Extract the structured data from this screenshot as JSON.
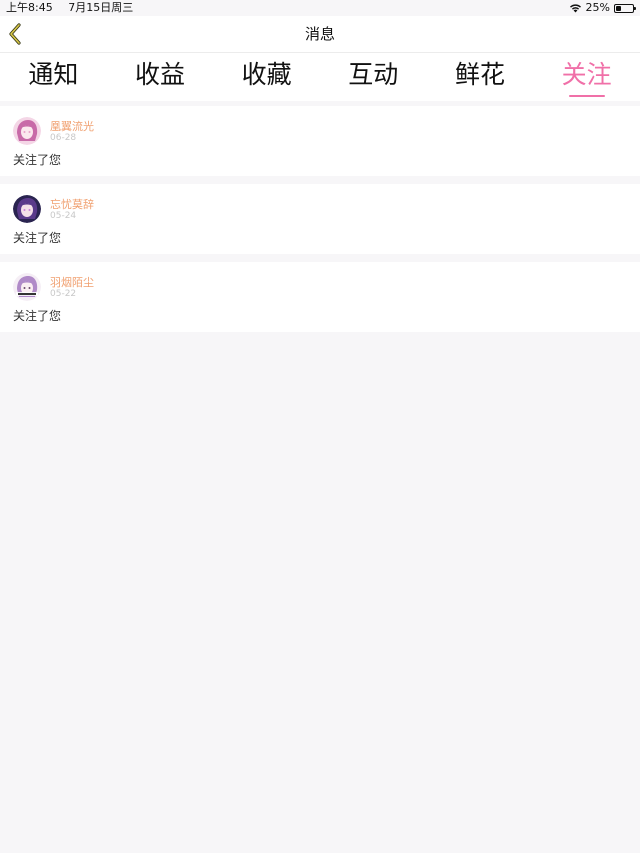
{
  "status_bar": {
    "time": "上午8:45",
    "date": "7月15日周三",
    "battery_percent": "25%",
    "battery_level": 0.25
  },
  "nav": {
    "title": "消息"
  },
  "tabs": [
    {
      "label": "通知",
      "active": false
    },
    {
      "label": "收益",
      "active": false
    },
    {
      "label": "收藏",
      "active": false
    },
    {
      "label": "互动",
      "active": false
    },
    {
      "label": "鲜花",
      "active": false
    },
    {
      "label": "关注",
      "active": true
    }
  ],
  "colors": {
    "accent": "#f070a8",
    "username": "#f0a070",
    "background": "#f7f6f8"
  },
  "notifications": [
    {
      "user": "凰翼流光",
      "date": "06-28",
      "message": "关注了您",
      "avatar_icon": "avatar-pink-anime"
    },
    {
      "user": "忘忧莫辞",
      "date": "05-24",
      "message": "关注了您",
      "avatar_icon": "avatar-purple-anime"
    },
    {
      "user": "羽烟陌尘",
      "date": "05-22",
      "message": "关注了您",
      "avatar_icon": "avatar-lilac-anime"
    }
  ]
}
